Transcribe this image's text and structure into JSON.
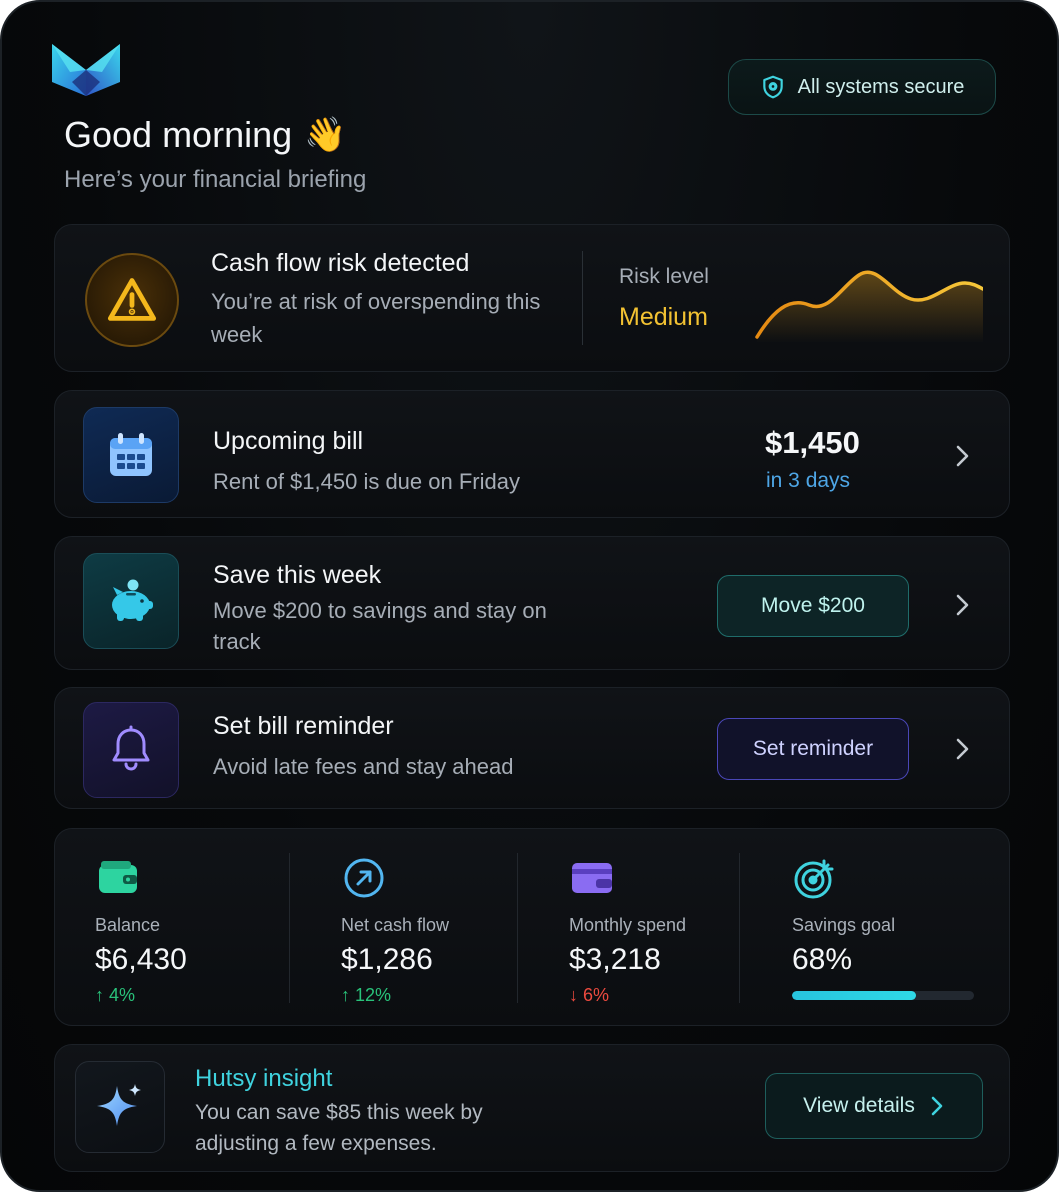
{
  "app": {
    "logo_icon": "hutsy-logo",
    "accent": "#3fd3df"
  },
  "status": {
    "label": "All systems secure",
    "icon": "shield-check-icon"
  },
  "header": {
    "greeting": "Good morning",
    "emoji": "👋",
    "subtitle": "Here’s your financial briefing"
  },
  "risk": {
    "title": "Cash flow risk detected",
    "description": "You’re at risk of overspending this week",
    "level_label": "Risk level",
    "level_value": "Medium",
    "level_color": "#f2c232",
    "icon": "warning-icon"
  },
  "bill": {
    "title": "Upcoming bill",
    "description": "Rent of $1,450 is due on Friday",
    "amount": "$1,450",
    "due": "in 3 days",
    "icon": "calendar-icon"
  },
  "save": {
    "title": "Save this week",
    "description": "Move $200 to savings and stay on track",
    "button": "Move $200",
    "icon": "piggy-bank-icon"
  },
  "reminder": {
    "title": "Set bill reminder",
    "description": "Avoid late fees and stay ahead",
    "button": "Set reminder",
    "icon": "bell-icon"
  },
  "stats": [
    {
      "label": "Balance",
      "value": "$6,430",
      "change": "↑ 4%",
      "trend": "up",
      "icon": "wallet-icon"
    },
    {
      "label": "Net cash flow",
      "value": "$1,286",
      "change": "↑ 12%",
      "trend": "up",
      "icon": "arrow-up-right-circle-icon"
    },
    {
      "label": "Monthly spend",
      "value": "$3,218",
      "change": "↓ 6%",
      "trend": "down",
      "icon": "card-icon"
    },
    {
      "label": "Savings goal",
      "value": "68%",
      "progress": 0.68,
      "icon": "target-icon"
    }
  ],
  "insight": {
    "title": "Hutsy insight",
    "description": "You can save $85 this week by adjusting a few expenses.",
    "button": "View details",
    "icon": "sparkle-icon"
  }
}
